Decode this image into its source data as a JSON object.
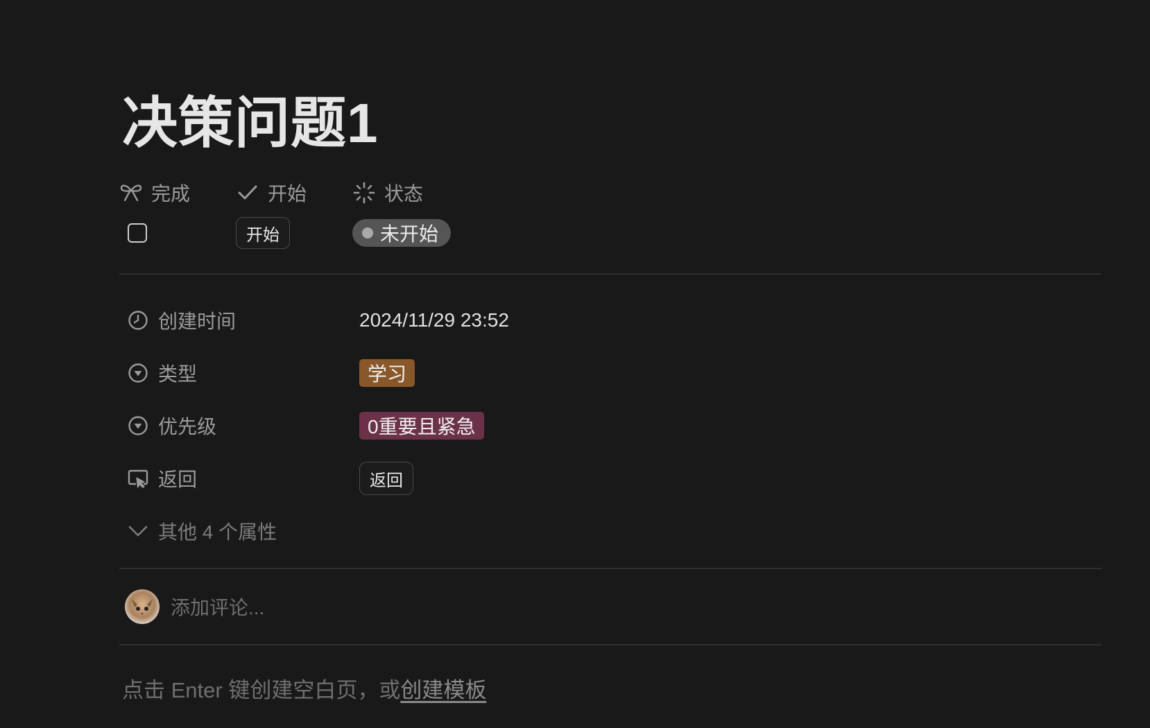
{
  "page": {
    "title": "决策问题1"
  },
  "top_properties": {
    "done": {
      "label": "完成",
      "icon": "bow-icon",
      "checked": false
    },
    "start": {
      "label": "开始",
      "icon": "checkmark-icon",
      "button_label": "开始"
    },
    "status": {
      "label": "状态",
      "icon": "loading-icon",
      "value": "未开始"
    }
  },
  "properties": [
    {
      "label": "创建时间",
      "icon": "clock-icon",
      "value": "2024/11/29 23:52"
    },
    {
      "label": "类型",
      "icon": "select-icon",
      "value": "学习",
      "color": "#89582a"
    },
    {
      "label": "优先级",
      "icon": "select-icon",
      "value": "0重要且紧急",
      "color": "#6b3148"
    },
    {
      "label": "返回",
      "icon": "cursor-click-icon",
      "button_label": "返回"
    }
  ],
  "more_properties": "其他 4 个属性",
  "comment": {
    "placeholder": "添加评论..."
  },
  "hint": {
    "text": "点击 Enter 键创建空白页，或",
    "link": "创建模板"
  },
  "colors": {
    "background": "#191919",
    "status_pill": "#555555"
  }
}
